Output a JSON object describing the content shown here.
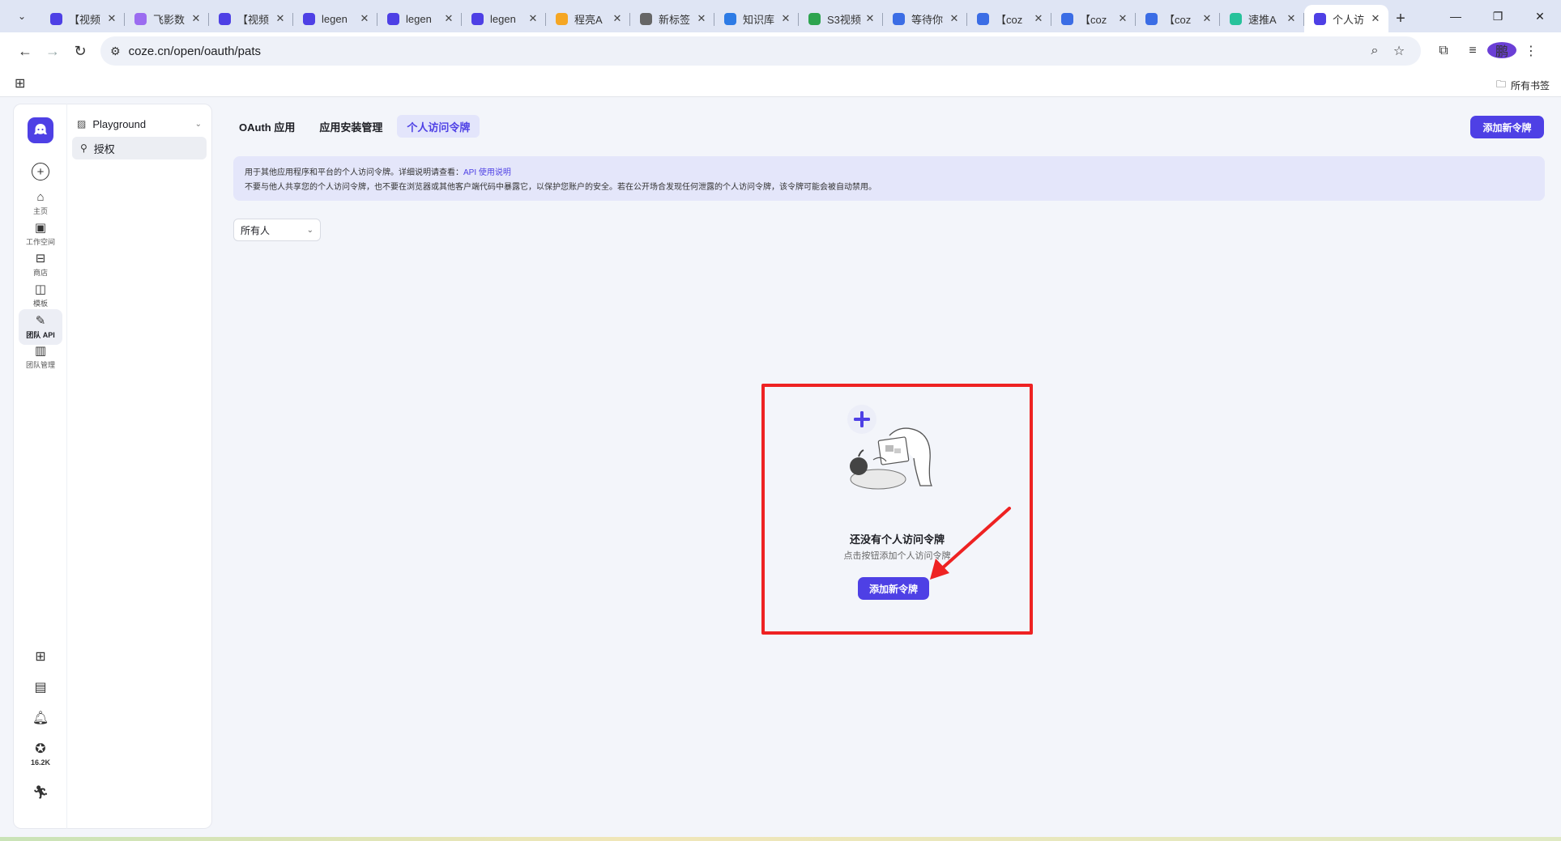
{
  "browser": {
    "tabs": [
      {
        "title": "【视频",
        "fav_color": "#4e40e5"
      },
      {
        "title": "飞影数",
        "fav_color": "#9b6cf0"
      },
      {
        "title": "【视频",
        "fav_color": "#4e40e5"
      },
      {
        "title": "legen",
        "fav_color": "#4e40e5"
      },
      {
        "title": "legen",
        "fav_color": "#4e40e5"
      },
      {
        "title": "legen",
        "fav_color": "#4e40e5"
      },
      {
        "title": "程亮A",
        "fav_color": "#f5a623"
      },
      {
        "title": "新标签",
        "fav_color": "#666666"
      },
      {
        "title": "知识库",
        "fav_color": "#2d7be5"
      },
      {
        "title": "S3视频",
        "fav_color": "#2ea44f"
      },
      {
        "title": "等待你",
        "fav_color": "#3b6de5"
      },
      {
        "title": "【coz",
        "fav_color": "#3b6de5"
      },
      {
        "title": "【coz",
        "fav_color": "#3b6de5"
      },
      {
        "title": "【coz",
        "fav_color": "#3b6de5"
      },
      {
        "title": "速推A",
        "fav_color": "#27c29b"
      },
      {
        "title": "个人访",
        "fav_color": "#4e40e5",
        "active": true
      }
    ],
    "url": "coze.cn/open/oauth/pats",
    "bookmarks_folder": "所有书签",
    "profile_initial": "鹏"
  },
  "rail": {
    "items": [
      {
        "label": "主页",
        "icon": "⌂"
      },
      {
        "label": "工作空间",
        "icon": "▣"
      },
      {
        "label": "商店",
        "icon": "⊟"
      },
      {
        "label": "模板",
        "icon": "◫"
      },
      {
        "label": "团队 API",
        "icon": "✎",
        "active": true
      },
      {
        "label": "团队管理",
        "icon": "▥"
      }
    ],
    "stars_count": "16.2K"
  },
  "sidebar": {
    "section_label": "Playground",
    "items": [
      {
        "label": "授权"
      }
    ]
  },
  "main": {
    "tabs": [
      {
        "label": "OAuth 应用"
      },
      {
        "label": "应用安装管理"
      },
      {
        "label": "个人访问令牌",
        "active": true
      }
    ],
    "add_button": "添加新令牌",
    "notice": {
      "line1_prefix": "用于其他应用程序和平台的个人访问令牌。详细说明请查看：",
      "line1_link": "API 使用说明",
      "line2": "不要与他人共享您的个人访问令牌，也不要在浏览器或其他客户端代码中暴露它，以保护您账户的安全。若在公开场合发现任何泄露的个人访问令牌，该令牌可能会被自动禁用。"
    },
    "filter_value": "所有人",
    "empty": {
      "title": "还没有个人访问令牌",
      "subtitle": "点击按钮添加个人访问令牌",
      "button": "添加新令牌"
    }
  },
  "colors": {
    "accent": "#4e40e5",
    "highlight_box": "#ee2222"
  }
}
